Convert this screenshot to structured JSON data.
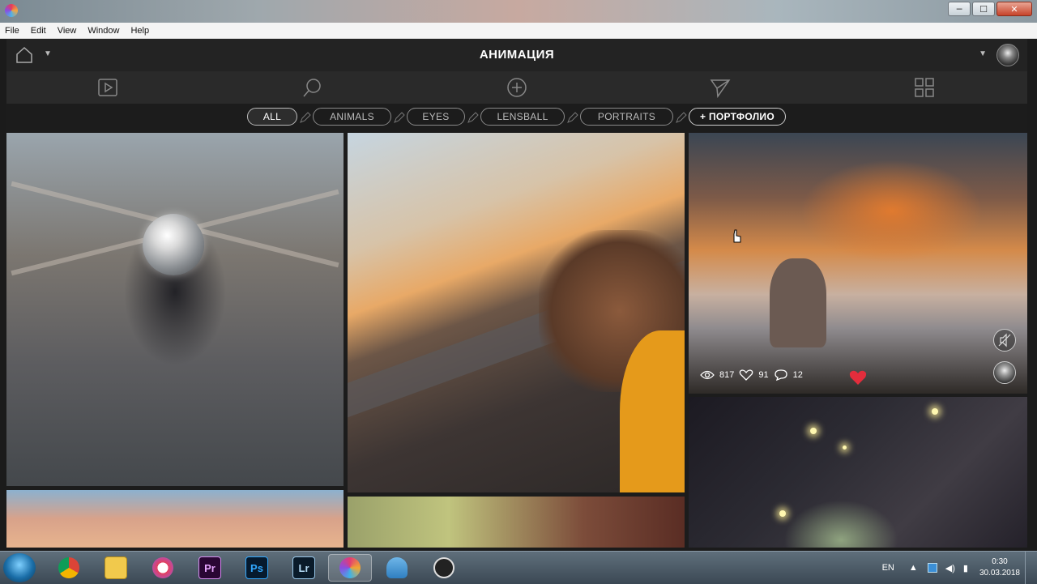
{
  "window": {
    "min_glyph": "─",
    "max_glyph": "☐",
    "close_glyph": "✕"
  },
  "menu": [
    "File",
    "Edit",
    "View",
    "Window",
    "Help"
  ],
  "header": {
    "title": "АНИМАЦИЯ"
  },
  "tags": {
    "all": "ALL",
    "animals": "ANIMALS",
    "eyes": "EYES",
    "lensball": "LENSBALL",
    "portraits": "PORTRAITS",
    "add_portfolio": "+ ПОРТФОЛИО"
  },
  "post": {
    "views": "817",
    "likes": "91",
    "comments": "12"
  },
  "taskbar": {
    "apps": [
      {
        "name": "Chrome",
        "icon": "chrome-icon"
      },
      {
        "name": "Explorer",
        "icon": "folder-icon"
      },
      {
        "name": "iTunes",
        "icon": "itunes-icon"
      },
      {
        "name": "Premiere",
        "label": "Pr"
      },
      {
        "name": "Photoshop",
        "label": "Ps"
      },
      {
        "name": "Lightroom",
        "label": "Lr"
      },
      {
        "name": "Picsart",
        "icon": "app-icon"
      },
      {
        "name": "Paint",
        "icon": "paint-icon"
      },
      {
        "name": "OBS",
        "icon": "obs-icon"
      }
    ],
    "lang": "EN",
    "time": "0:30",
    "date": "30.03.2018"
  },
  "colors": {
    "accent": "#e32d3c",
    "bg": "#1c1c1c"
  }
}
